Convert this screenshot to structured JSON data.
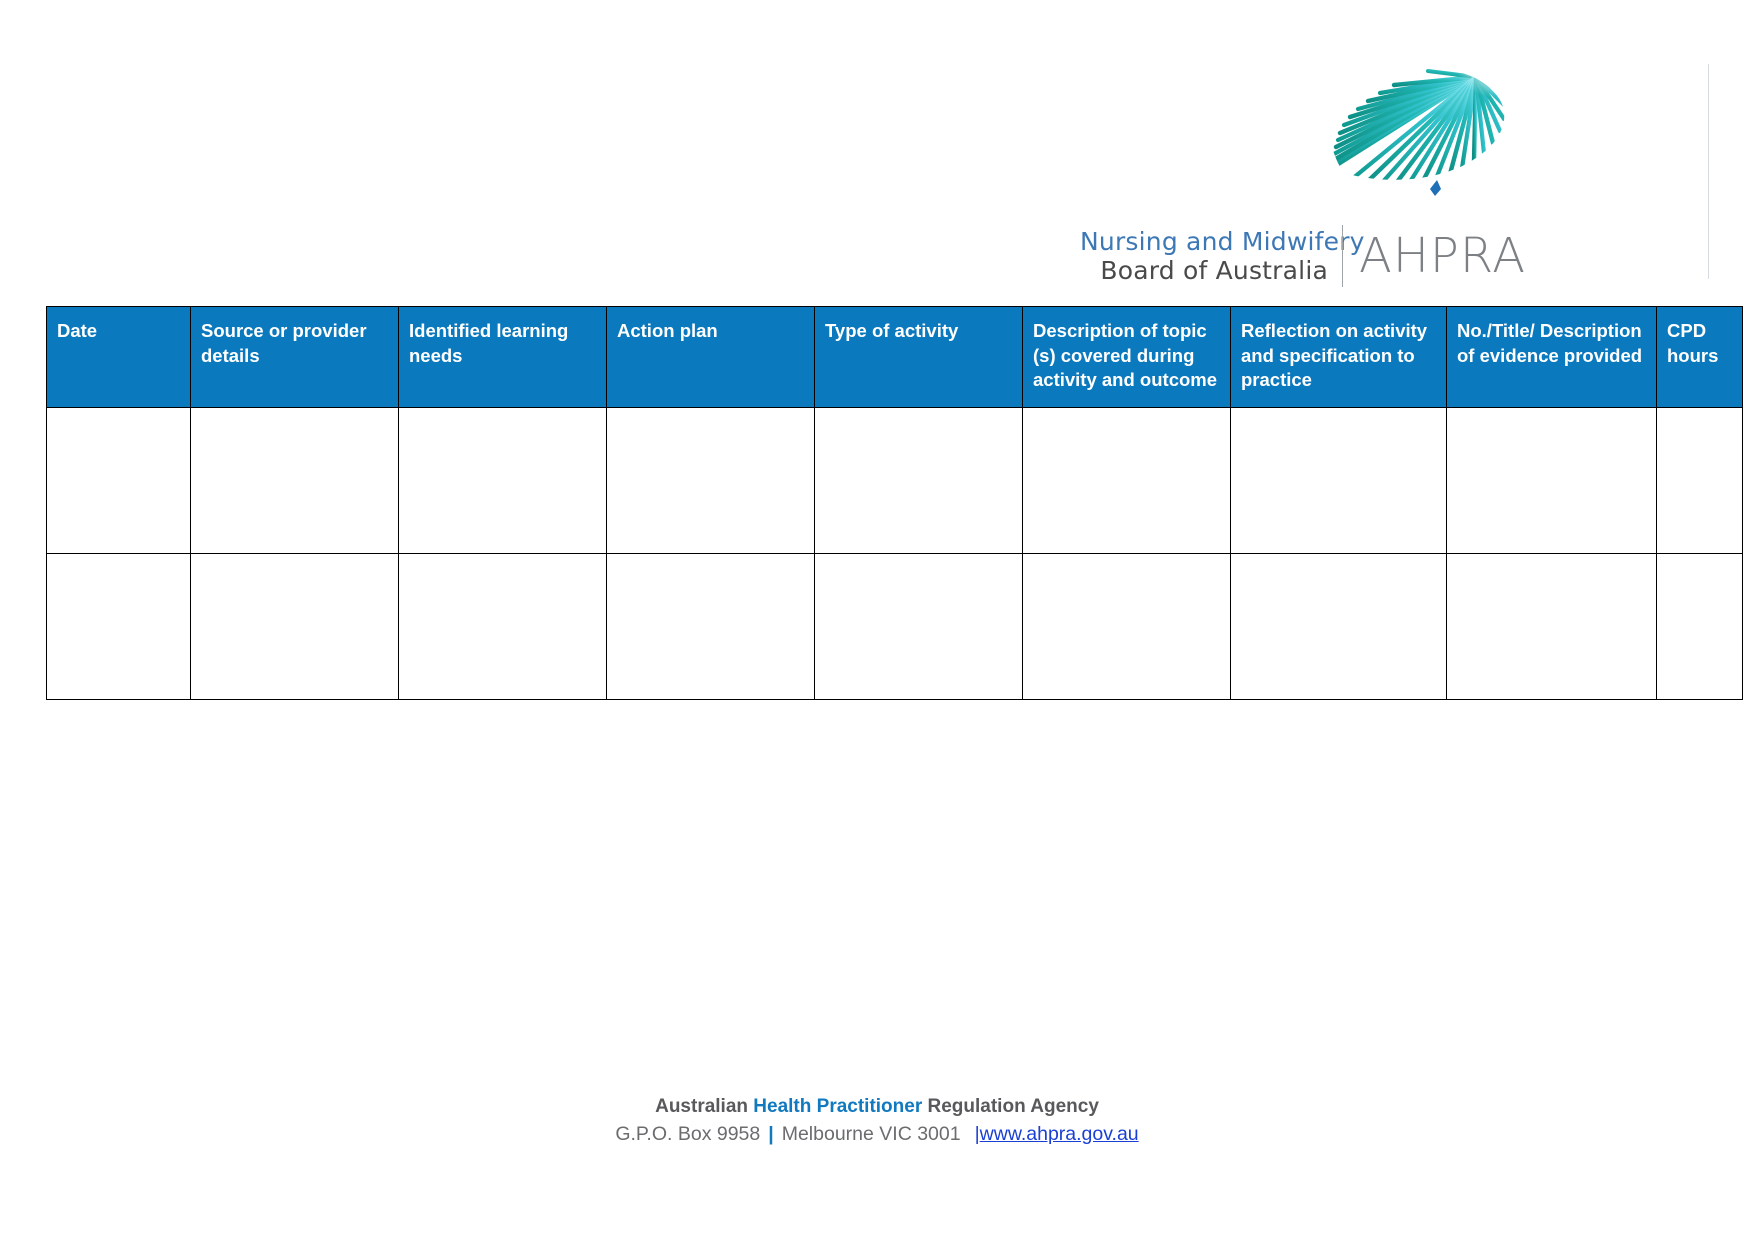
{
  "logo": {
    "mark_name": "australia-radial-lines-logo",
    "board_line_1": "Nursing and Midwifery",
    "board_line_2": "Board of Australia",
    "agency_acronym": "AHPRA",
    "colors": {
      "mark_teal": "#17a398",
      "mark_cyan": "#2fc3d8",
      "mark_blue": "#1e6fb8",
      "board_text": "#3d78b5",
      "board_text_2": "#4a4a4a",
      "acronym": "#7d8185"
    }
  },
  "table": {
    "name": "cpd-record-table",
    "columns": [
      "Date",
      "Source or provider details",
      "Identified learning needs",
      "Action plan",
      "Type of activity",
      "Description of topic (s) covered during activity and outcome",
      "Reflection on activity and specification to practice",
      "No./Title/ Description of evidence provided",
      "CPD hours"
    ],
    "header_background": "#0b79be",
    "header_text_color": "#ffffff",
    "rows": [
      [
        "",
        "",
        "",
        "",
        "",
        "",
        "",
        "",
        ""
      ],
      [
        "",
        "",
        "",
        "",
        "",
        "",
        "",
        "",
        ""
      ]
    ]
  },
  "footer": {
    "org_prefix": "Australian ",
    "org_highlight": "Health Practitioner",
    "org_suffix": " Regulation Agency",
    "po_box": "G.P.O. Box 9958",
    "separator": "|",
    "city": "Melbourne VIC 3001",
    "url_pipe": "|",
    "url": "www.ahpra.gov.au",
    "highlight_color": "#1179bf",
    "link_color": "#1a3fd4"
  }
}
